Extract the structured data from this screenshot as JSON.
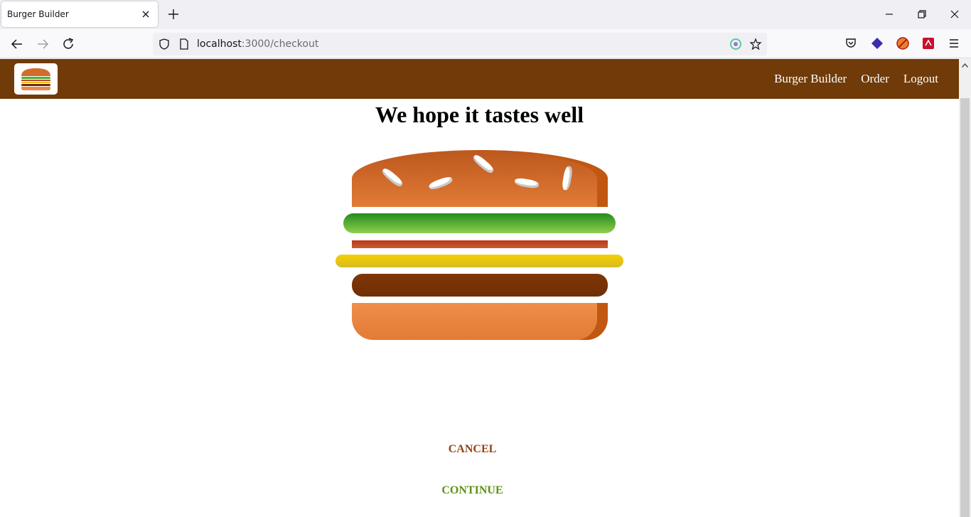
{
  "browser": {
    "tab_title": "Burger Builder",
    "url_host": "localhost",
    "url_rest": ":3000/checkout"
  },
  "icons": {
    "tab_close": "close-icon",
    "new_tab": "plus-icon",
    "back": "arrow-left-icon",
    "forward": "arrow-right-icon",
    "reload": "reload-icon",
    "shield": "shield-icon",
    "page": "page-icon",
    "bookmark": "star-icon",
    "menu": "hamburger-menu-icon"
  },
  "toolbar": {
    "nav": [
      "Burger Builder",
      "Order",
      "Logout"
    ]
  },
  "checkout": {
    "heading": "We hope it tastes well",
    "cancel_label": "CANCEL",
    "continue_label": "CONTINUE"
  },
  "burger": {
    "ingredients": [
      "bread-top",
      "salad",
      "bacon",
      "cheese",
      "meat",
      "bread-bottom"
    ]
  },
  "colors": {
    "toolbar_bg": "#703b09",
    "cancel": "#944317",
    "continue": "#5c9210"
  }
}
